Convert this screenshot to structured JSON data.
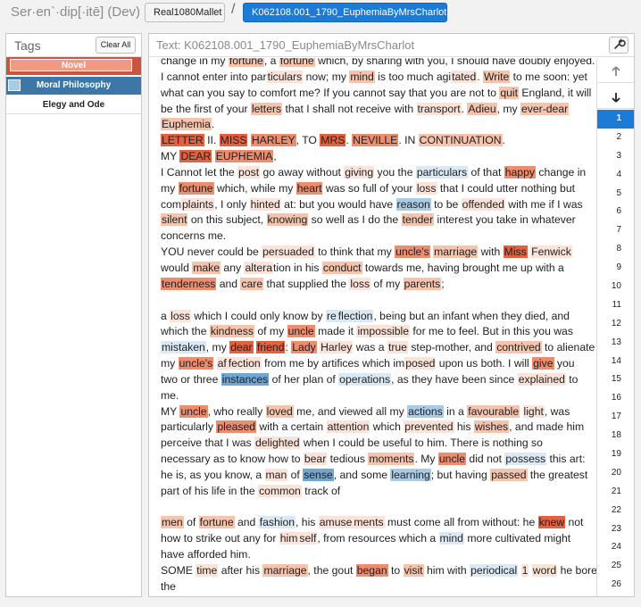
{
  "app": {
    "title": "Ser·en`·dip[·itē] (Dev)"
  },
  "breadcrumb": {
    "corpus": "Real1080Mallet",
    "separator": "/",
    "text": "K062108.001_1790_EuphemiaByMrsCharlot"
  },
  "tags_panel": {
    "title": "Tags",
    "clear_all": "Clear All",
    "tags": [
      {
        "label": "Novel",
        "color": "#c8553d"
      },
      {
        "label": "Moral Philosophy",
        "color": "#3d77a8"
      },
      {
        "label": "Elegy and Ode"
      }
    ]
  },
  "text_panel": {
    "title": "Text: K062108.001_1790_EuphemiaByMrsCharlot",
    "wrench_icon": "wrench-icon",
    "up_icon": "arrow-up-icon",
    "down_icon": "arrow-down-icon",
    "active_line": 1,
    "line_numbers": [
      "1",
      "2",
      "3",
      "4",
      "5",
      "6",
      "7",
      "8",
      "9",
      "10",
      "11",
      "12",
      "13",
      "14",
      "15",
      "16",
      "17",
      "18",
      "19",
      "20",
      "21",
      "22",
      "23",
      "24",
      "25",
      "26"
    ],
    "lines": [
      [
        [
          "change in my ",
          ""
        ],
        [
          "fortune",
          "h2"
        ],
        [
          ", a ",
          ""
        ],
        [
          "fortune",
          "h2"
        ],
        [
          " which, by sharing with you, I should have doubly enjoyed.",
          ""
        ]
      ],
      [
        [
          "I cannot enter into par",
          ""
        ],
        [
          "ticulars",
          "h1"
        ],
        [
          " now; my ",
          ""
        ],
        [
          "mind",
          "h2"
        ],
        [
          " is too much agi",
          ""
        ],
        [
          "tated",
          "h1"
        ],
        [
          ". ",
          ""
        ],
        [
          "Write",
          "h2"
        ],
        [
          " to me soon: yet",
          ""
        ]
      ],
      [
        [
          "what can you say to comfort me? If you cannot say that you are not to ",
          ""
        ],
        [
          "quit",
          "h2"
        ],
        [
          " England, it will",
          ""
        ]
      ],
      [
        [
          "be the first of your ",
          ""
        ],
        [
          "letters",
          "h2"
        ],
        [
          " that I shall not receive with ",
          ""
        ],
        [
          "transport",
          "h1"
        ],
        [
          ". ",
          ""
        ],
        [
          "Adieu",
          "h2"
        ],
        [
          ", my ",
          ""
        ],
        [
          "ever-dear",
          "h2"
        ]
      ],
      [
        [
          "Euphemia",
          "h2"
        ],
        [
          ".",
          ""
        ]
      ],
      [
        [
          "LETTER",
          "h4"
        ],
        [
          " II. ",
          ""
        ],
        [
          "MISS",
          "h4"
        ],
        [
          " ",
          ""
        ],
        [
          "HARLEY",
          "h3"
        ],
        [
          ", TO ",
          ""
        ],
        [
          "MRS",
          "h4"
        ],
        [
          ". ",
          ""
        ],
        [
          "NEVILLE",
          "h3"
        ],
        [
          ". IN ",
          ""
        ],
        [
          "CONTINUATION",
          "h2"
        ],
        [
          ".",
          ""
        ]
      ],
      [
        [
          "MY ",
          ""
        ],
        [
          "DEAR",
          "h4"
        ],
        [
          " ",
          ""
        ],
        [
          "EUPHEMIA",
          "h3"
        ],
        [
          ",",
          ""
        ]
      ],
      [
        [
          "I Cannot let the ",
          ""
        ],
        [
          "post",
          "h1"
        ],
        [
          " go away without ",
          ""
        ],
        [
          "giving",
          "h1"
        ],
        [
          " you the ",
          ""
        ],
        [
          "particulars",
          "b1"
        ],
        [
          " of that ",
          ""
        ],
        [
          "happy",
          "h3"
        ],
        [
          " change in",
          ""
        ]
      ],
      [
        [
          "my ",
          ""
        ],
        [
          "fortune",
          "h3"
        ],
        [
          " which, while my ",
          ""
        ],
        [
          "heart",
          "h3"
        ],
        [
          " was so full of your ",
          ""
        ],
        [
          "loss",
          "h1"
        ],
        [
          " that I could utter nothing but",
          ""
        ]
      ],
      [
        [
          "com",
          ""
        ],
        [
          "plaints",
          "h1"
        ],
        [
          ", I only ",
          ""
        ],
        [
          "hinted",
          "h1"
        ],
        [
          " at: but you would have ",
          ""
        ],
        [
          "reason",
          "b2"
        ],
        [
          " to be ",
          ""
        ],
        [
          "offended",
          "h1"
        ],
        [
          " with me if I was",
          ""
        ]
      ],
      [
        [
          "silent",
          "h2"
        ],
        [
          " on this subject, ",
          ""
        ],
        [
          "knowing",
          "h2"
        ],
        [
          " so well as I do the ",
          ""
        ],
        [
          "tender",
          "h2"
        ],
        [
          " interest you take in whatever",
          ""
        ]
      ],
      [
        [
          "concerns me.",
          ""
        ]
      ],
      [
        [
          "YOU never could be ",
          ""
        ],
        [
          "persuaded",
          "h1"
        ],
        [
          " to think that my ",
          ""
        ],
        [
          "uncle's",
          "h3"
        ],
        [
          " ",
          ""
        ],
        [
          "marriage",
          "h2"
        ],
        [
          " with ",
          ""
        ],
        [
          "Miss",
          "h4"
        ],
        [
          " ",
          ""
        ],
        [
          "Fenwick",
          "h1"
        ]
      ],
      [
        [
          "would ",
          ""
        ],
        [
          "make",
          "h2"
        ],
        [
          " any ",
          ""
        ],
        [
          "altera",
          "h1"
        ],
        [
          "tion in his ",
          ""
        ],
        [
          "conduct",
          "h2"
        ],
        [
          " towards me, having brought me up with a",
          ""
        ]
      ],
      [
        [
          "tenderness",
          "h3"
        ],
        [
          " and ",
          ""
        ],
        [
          "care",
          "h2"
        ],
        [
          " that supplied the ",
          ""
        ],
        [
          "loss",
          "h1"
        ],
        [
          " of my ",
          ""
        ],
        [
          "parents",
          "h2"
        ],
        [
          ";",
          ""
        ]
      ],
      [
        [
          "",
          ""
        ]
      ],
      [
        [
          "a ",
          ""
        ],
        [
          "loss",
          "h1"
        ],
        [
          " which I could only know by ",
          ""
        ],
        [
          "re",
          "b1"
        ],
        [
          "flection",
          "b1"
        ],
        [
          ", being but an infant when they died, and",
          ""
        ]
      ],
      [
        [
          "which the ",
          ""
        ],
        [
          "kindness",
          "h2"
        ],
        [
          " of my ",
          ""
        ],
        [
          "uncle",
          "h3"
        ],
        [
          " made it ",
          ""
        ],
        [
          "impossible",
          "h1"
        ],
        [
          " for me to feel. But in this you was",
          ""
        ]
      ],
      [
        [
          "mistaken",
          "b1"
        ],
        [
          ", my ",
          ""
        ],
        [
          "dear",
          "h4"
        ],
        [
          " ",
          ""
        ],
        [
          "friend",
          "h4"
        ],
        [
          ": ",
          ""
        ],
        [
          "Lady",
          "h3"
        ],
        [
          " ",
          ""
        ],
        [
          "Harley",
          "h1"
        ],
        [
          " was a ",
          ""
        ],
        [
          "true",
          "h1"
        ],
        [
          " step-mother, and ",
          ""
        ],
        [
          "contrived",
          "h2"
        ],
        [
          " to alienate",
          ""
        ]
      ],
      [
        [
          "my ",
          ""
        ],
        [
          "uncle's",
          "h3"
        ],
        [
          " ",
          ""
        ],
        [
          "af",
          "h1"
        ],
        [
          "fection",
          "h1"
        ],
        [
          " from me by artifices which im",
          ""
        ],
        [
          "posed",
          "h1"
        ],
        [
          " upon us both. I will ",
          ""
        ],
        [
          "give",
          "h3"
        ],
        [
          " you",
          ""
        ]
      ],
      [
        [
          "two or three ",
          ""
        ],
        [
          "instances",
          "b3"
        ],
        [
          " of her plan of ",
          ""
        ],
        [
          "operations",
          "b1"
        ],
        [
          ", as they have been since ",
          ""
        ],
        [
          "explained",
          "h1"
        ],
        [
          " to",
          ""
        ]
      ],
      [
        [
          "me.",
          ""
        ]
      ],
      [
        [
          "MY ",
          ""
        ],
        [
          "uncle",
          "h3"
        ],
        [
          ", who really ",
          ""
        ],
        [
          "loved",
          "h2"
        ],
        [
          " me, and viewed all my ",
          ""
        ],
        [
          "actions",
          "b2"
        ],
        [
          " in a ",
          ""
        ],
        [
          "favourable",
          "h2"
        ],
        [
          " ",
          ""
        ],
        [
          "light",
          "h1"
        ],
        [
          ", was",
          ""
        ]
      ],
      [
        [
          "particularly ",
          ""
        ],
        [
          "pleased",
          "h3"
        ],
        [
          " with a certain ",
          ""
        ],
        [
          "attention",
          "h1"
        ],
        [
          " which ",
          ""
        ],
        [
          "prevented",
          "h1"
        ],
        [
          " his ",
          ""
        ],
        [
          "wishes",
          "h2"
        ],
        [
          ", and made him",
          ""
        ]
      ],
      [
        [
          "perceive that I was ",
          ""
        ],
        [
          "delighted",
          "h1"
        ],
        [
          " when I could be useful to him. There is nothing so",
          ""
        ]
      ],
      [
        [
          "necessary as to know how to ",
          ""
        ],
        [
          "bear",
          "h1"
        ],
        [
          " tedious ",
          ""
        ],
        [
          "moments",
          "h2"
        ],
        [
          ". My ",
          ""
        ],
        [
          "uncle",
          "h3"
        ],
        [
          " did not ",
          ""
        ],
        [
          "possess",
          "b1"
        ],
        [
          " this art:",
          ""
        ]
      ],
      [
        [
          "he is, as you know, a ",
          ""
        ],
        [
          "man",
          "h1"
        ],
        [
          " of ",
          ""
        ],
        [
          "sense",
          "b3"
        ],
        [
          ", and some ",
          ""
        ],
        [
          "learning",
          "b2"
        ],
        [
          "; but having ",
          ""
        ],
        [
          "passed",
          "h2"
        ],
        [
          " the greatest",
          ""
        ]
      ],
      [
        [
          "part of his life in the ",
          ""
        ],
        [
          "common",
          "h1"
        ],
        [
          " track of",
          ""
        ]
      ],
      [
        [
          "",
          ""
        ]
      ],
      [
        [
          "men",
          "h2"
        ],
        [
          " of ",
          ""
        ],
        [
          "fortune",
          "h2"
        ],
        [
          " and ",
          ""
        ],
        [
          "fashion",
          "b1"
        ],
        [
          ", his ",
          ""
        ],
        [
          "amuse",
          "h1"
        ],
        [
          "ments",
          "h1"
        ],
        [
          " must come all from without: he ",
          ""
        ],
        [
          "knew",
          "h4"
        ],
        [
          " not",
          ""
        ]
      ],
      [
        [
          "how to strike out any for ",
          ""
        ],
        [
          "him",
          "h1"
        ],
        [
          "self",
          "h1"
        ],
        [
          ", from resources which a ",
          ""
        ],
        [
          "mind",
          "b1"
        ],
        [
          " more cultivated might",
          ""
        ]
      ],
      [
        [
          "have afforded him.",
          ""
        ]
      ],
      [
        [
          "SOME ",
          ""
        ],
        [
          "time",
          "h1"
        ],
        [
          " after his ",
          ""
        ],
        [
          "marriage",
          "h2"
        ],
        [
          ", the gout ",
          ""
        ],
        [
          "began",
          "h3"
        ],
        [
          " to ",
          ""
        ],
        [
          "visit",
          "h2"
        ],
        [
          " him with ",
          ""
        ],
        [
          "periodical",
          "b1"
        ],
        [
          " ",
          ""
        ],
        [
          "1",
          "h1"
        ],
        [
          " ",
          ""
        ],
        [
          "word",
          "h1"
        ],
        [
          " he bore",
          ""
        ]
      ],
      [
        [
          "the",
          ""
        ]
      ]
    ]
  }
}
